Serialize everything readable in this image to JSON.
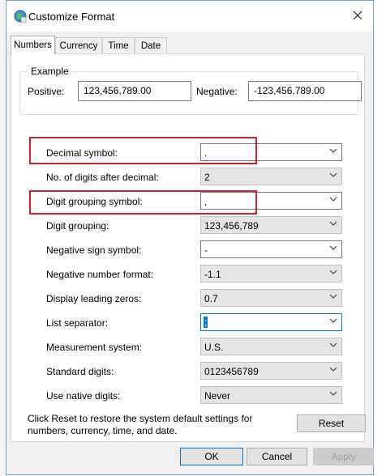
{
  "window": {
    "title": "Customize Format"
  },
  "tabs": [
    "Numbers",
    "Currency",
    "Time",
    "Date"
  ],
  "example": {
    "label": "Example",
    "positive_label": "Positive:",
    "positive_value": "123,456,789.00",
    "negative_label": "Negative:",
    "negative_value": "-123,456,789.00"
  },
  "settings": [
    {
      "label": "Decimal symbol:",
      "value": "."
    },
    {
      "label": "No. of digits after decimal:",
      "value": "2"
    },
    {
      "label": "Digit grouping symbol:",
      "value": ","
    },
    {
      "label": "Digit grouping:",
      "value": "123,456,789"
    },
    {
      "label": "Negative sign symbol:",
      "value": "-"
    },
    {
      "label": "Negative number format:",
      "value": "-1.1"
    },
    {
      "label": "Display leading zeros:",
      "value": "0.7"
    },
    {
      "label": "List separator:",
      "value": ";"
    },
    {
      "label": "Measurement system:",
      "value": "U.S."
    },
    {
      "label": "Standard digits:",
      "value": "0123456789"
    },
    {
      "label": "Use native digits:",
      "value": "Never"
    }
  ],
  "footnote": "Click Reset to restore the system default settings for numbers, currency, time, and date.",
  "buttons": {
    "reset": "Reset",
    "ok": "OK",
    "cancel": "Cancel",
    "apply": "Apply"
  },
  "colors": {
    "highlight": "#d0222e",
    "focus": "#0078d7",
    "background_text": "#2e7d32"
  }
}
